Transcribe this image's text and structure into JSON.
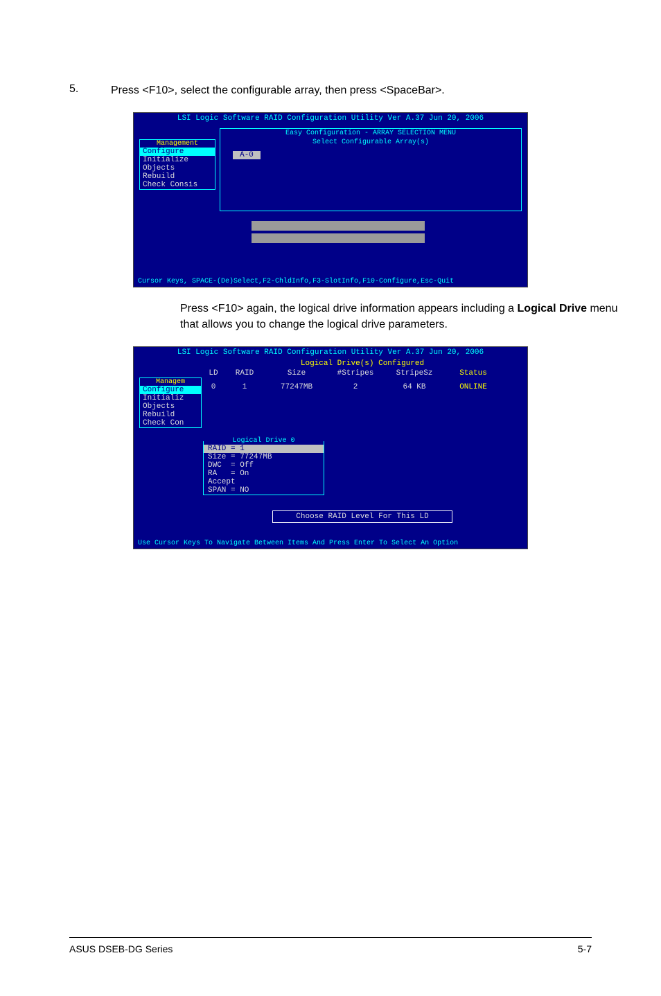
{
  "step": {
    "number": "5.",
    "text": "Press <F10>, select the configurable array, then press <SpaceBar>."
  },
  "screenshot1": {
    "titlebar": "LSI Logic Software RAID Configuration Utility Ver A.37 Jun 20, 2006",
    "menu_title": "Management",
    "menu_items": [
      "Configure",
      "Initialize",
      "Objects",
      "Rebuild",
      "Check Consis"
    ],
    "config_title": "Easy Configuration - ARRAY SELECTION MENU",
    "config_subtitle": "Select Configurable Array(s)",
    "array_cell": "A-0",
    "footer": "Cursor Keys, SPACE-(De)Select,F2-ChldInfo,F3-SlotInfo,F10-Configure,Esc-Quit"
  },
  "body_text": {
    "part1": "Press <F10> again, the logical drive information appears including a ",
    "bold": "Logical Drive",
    "part2": " menu that allows you to change the logical drive parameters."
  },
  "screenshot2": {
    "titlebar": "LSI Logic Software RAID Configuration Utility Ver A.37 Jun 20, 2006",
    "table_title": "Logical Drive(s) Configured",
    "headers": {
      "ld": "LD",
      "raid": "RAID",
      "size": "Size",
      "stripes": "#Stripes",
      "stripesz": "StripeSz",
      "status": "Status"
    },
    "row": {
      "ld": "0",
      "raid": "1",
      "size": "77247MB",
      "stripes": "2",
      "stripesz": "64  KB",
      "status": "ONLINE"
    },
    "menu_title": "Managem",
    "menu_items": [
      "Configure",
      "Initializ",
      "Objects",
      "Rebuild",
      "Check Con"
    ],
    "ld_title": "Logical Drive 0",
    "ld_lines": [
      "RAID = 1",
      "Size = 77247MB",
      "DWC  = Off",
      "RA   = On",
      "Accept",
      "SPAN = NO"
    ],
    "msg": "Choose RAID Level For This LD",
    "footer": "Use Cursor Keys To Navigate Between Items And Press Enter To Select An Option"
  },
  "page_footer": {
    "left": "ASUS DSEB-DG Series",
    "right": "5-7"
  }
}
